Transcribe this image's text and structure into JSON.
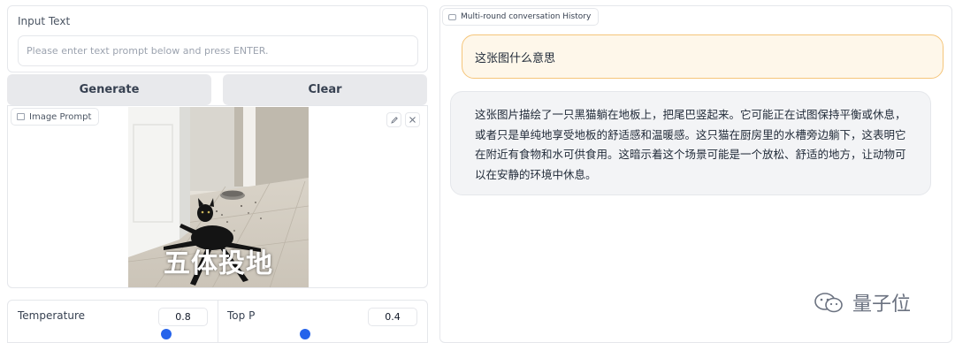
{
  "input": {
    "label": "Input Text",
    "placeholder": "Please enter text prompt below and press ENTER."
  },
  "buttons": {
    "generate": "Generate",
    "clear": "Clear"
  },
  "image_prompt": {
    "label": "Image Prompt",
    "caption": "五体投地",
    "edit_icon": "pencil-icon",
    "close_icon": "close-icon"
  },
  "params": {
    "temperature": {
      "label": "Temperature",
      "value": "0.8"
    },
    "top_p": {
      "label": "Top P",
      "value": "0.4"
    }
  },
  "chat": {
    "label": "Multi-round conversation History",
    "messages": [
      {
        "role": "user",
        "text": "这张图什么意思"
      },
      {
        "role": "assistant",
        "text": "这张图片描绘了一只黑猫躺在地板上，把尾巴竖起来。它可能正在试图保持平衡或休息，或者只是单纯地享受地板的舒适感和温暖感。这只猫在厨房里的水槽旁边躺下，这表明它在附近有食物和水可供食用。这暗示着这个场景可能是一个放松、舒适的地方，让动物可以在安静的环境中休息。"
      }
    ]
  },
  "watermark": "量子位",
  "colors": {
    "accent": "#2563eb",
    "user_bubble_bg": "#fef7ea",
    "user_bubble_border": "#f5c57a",
    "bot_bubble_bg": "#f3f4f6"
  }
}
